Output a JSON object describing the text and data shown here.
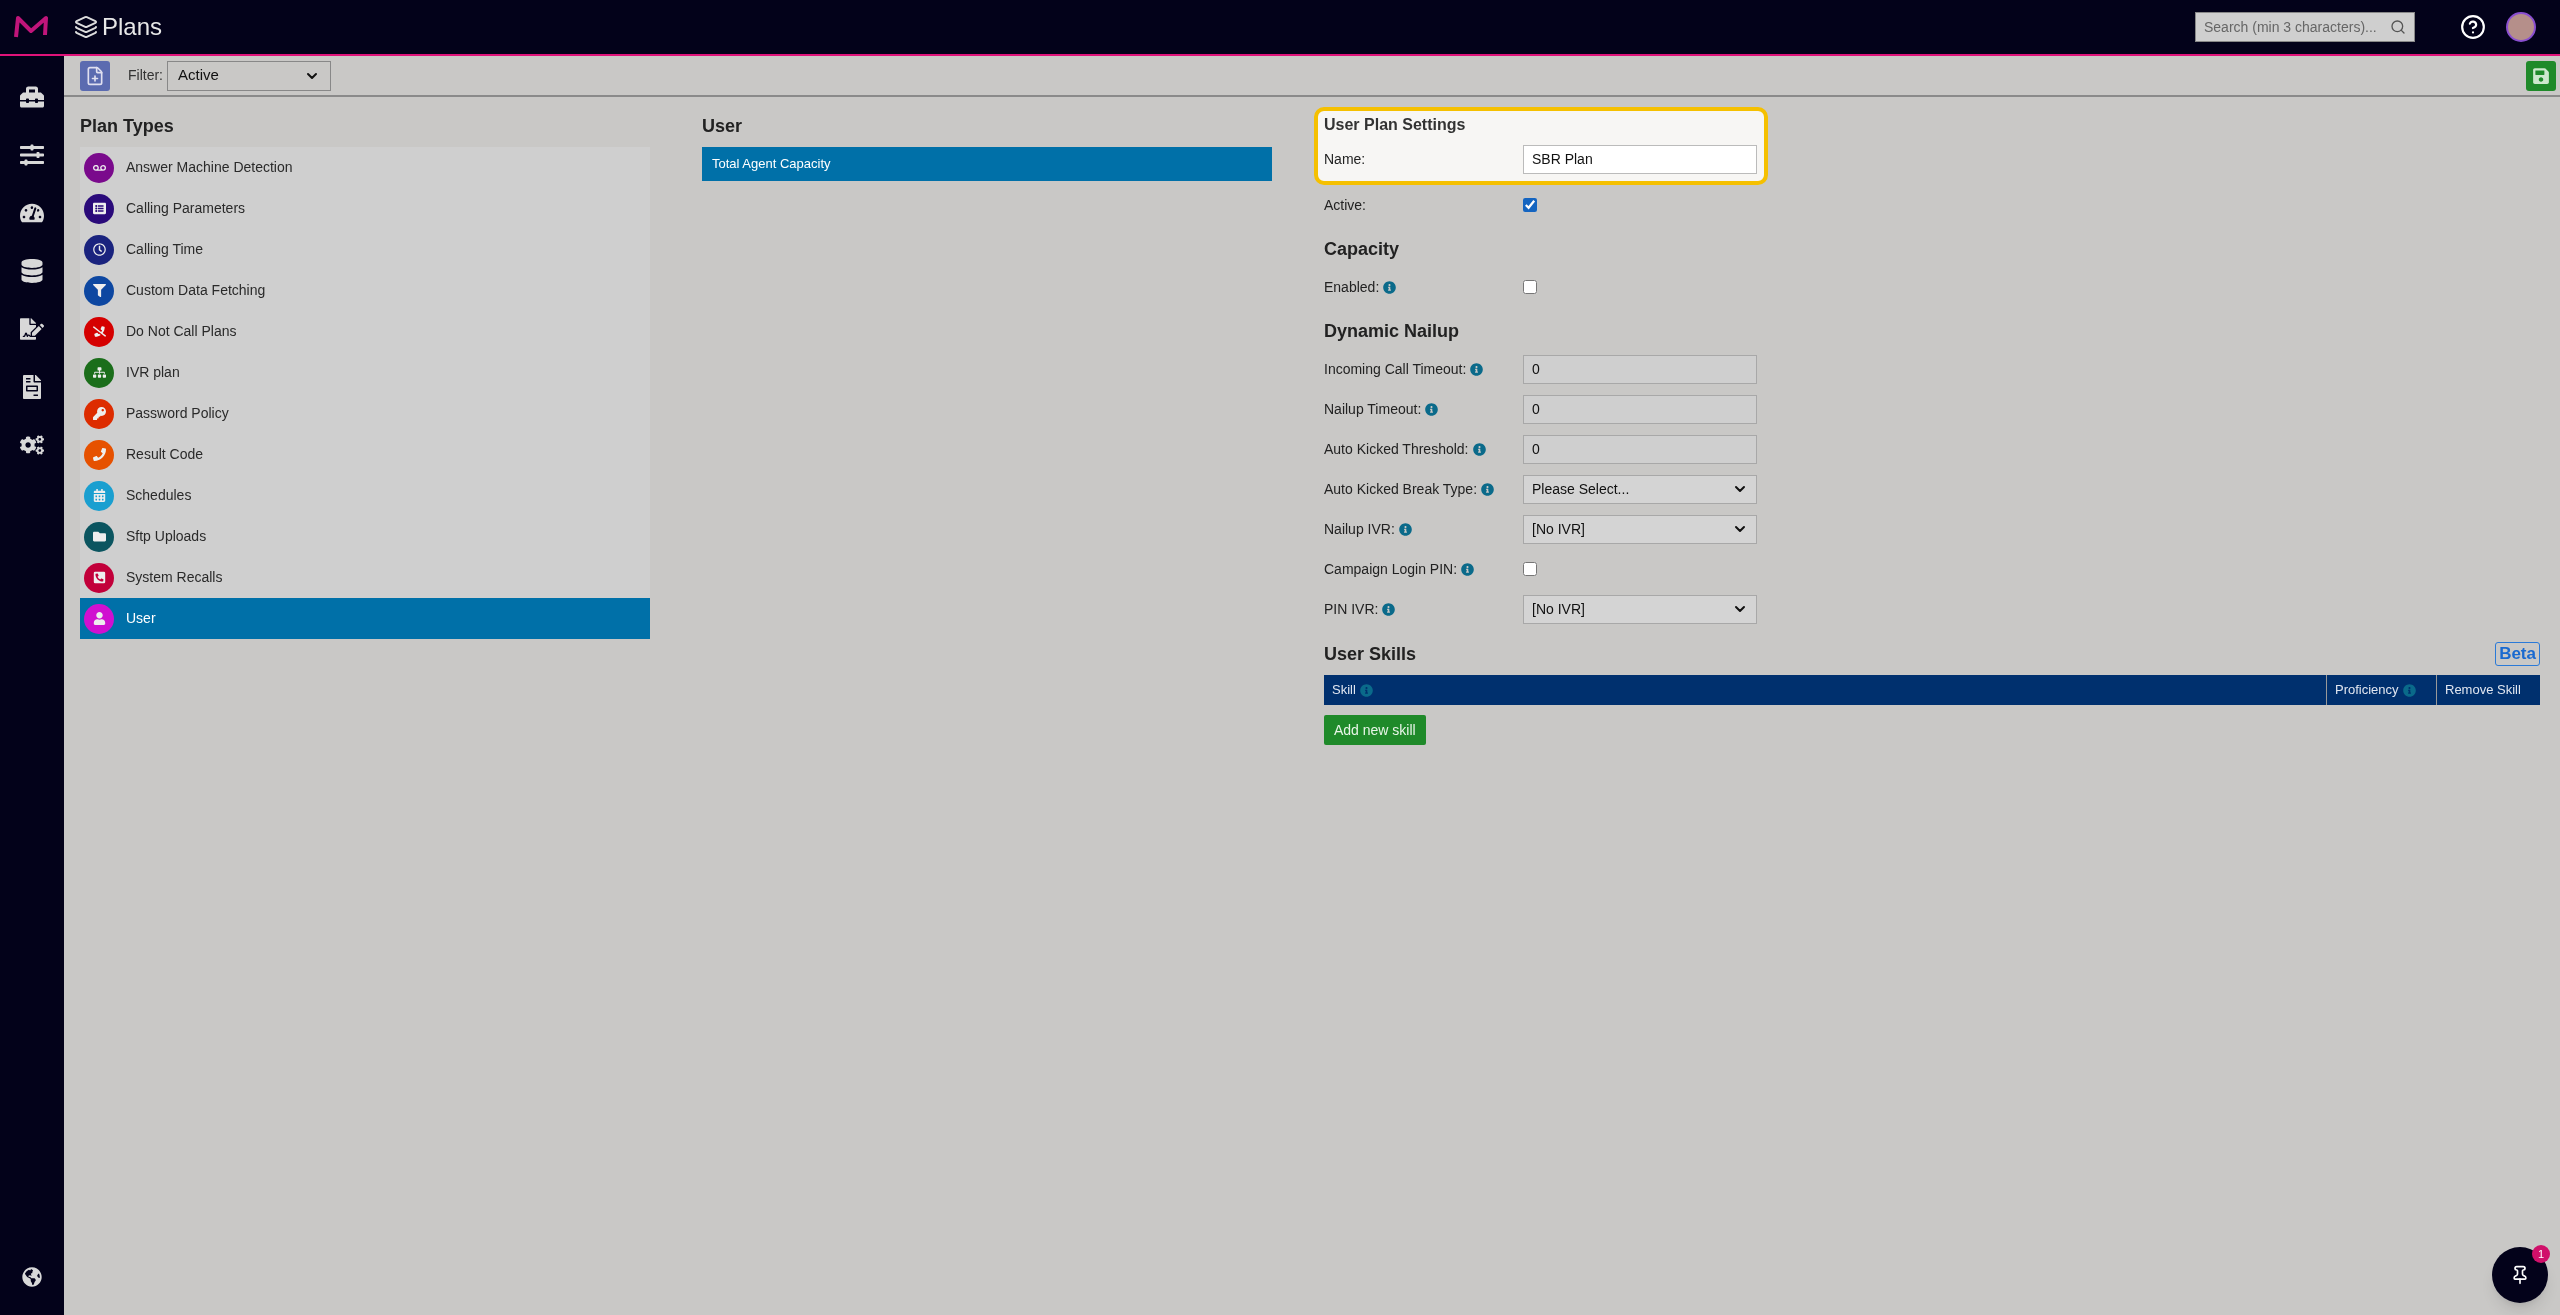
{
  "header": {
    "title": "Plans",
    "search": {
      "placeholder": "Search (min 3 characters)..."
    }
  },
  "toolbar": {
    "filter_label": "Filter:",
    "filter_value": "Active"
  },
  "plan_types": {
    "title": "Plan Types",
    "items": [
      {
        "label": "Answer Machine Detection",
        "color": "#7a0a8c",
        "selected": false
      },
      {
        "label": "Calling Parameters",
        "color": "#2a0a7a",
        "selected": false
      },
      {
        "label": "Calling Time",
        "color": "#1a237e",
        "selected": false
      },
      {
        "label": "Custom Data Fetching",
        "color": "#0d47a1",
        "selected": false
      },
      {
        "label": "Do Not Call Plans",
        "color": "#d50000",
        "selected": false
      },
      {
        "label": "IVR plan",
        "color": "#1b6e1b",
        "selected": false
      },
      {
        "label": "Password Policy",
        "color": "#dd2c00",
        "selected": false
      },
      {
        "label": "Result Code",
        "color": "#e65100",
        "selected": false
      },
      {
        "label": "Schedules",
        "color": "#1a9fd0",
        "selected": false
      },
      {
        "label": "Sftp Uploads",
        "color": "#0b5560",
        "selected": false
      },
      {
        "label": "System Recalls",
        "color": "#c2003a",
        "selected": false
      },
      {
        "label": "User",
        "color": "#d010d0",
        "selected": true
      }
    ]
  },
  "user": {
    "title": "User",
    "items": [
      {
        "label": "Total Agent Capacity",
        "selected": true
      }
    ]
  },
  "settings": {
    "title": "User Plan Settings",
    "highlighted": true,
    "name_field": {
      "label": "Name:",
      "value": "SBR Plan"
    },
    "sections": [
      {
        "rows": [
          {
            "kind": "checkbox",
            "label": "Active:",
            "info": false,
            "checked": true
          }
        ]
      },
      {
        "title": "Capacity",
        "rows": [
          {
            "kind": "checkbox",
            "label": "Enabled:",
            "info": true,
            "checked": false
          }
        ]
      },
      {
        "title": "Dynamic Nailup",
        "rows": [
          {
            "kind": "text",
            "label": "Incoming Call Timeout:",
            "info": true,
            "value": "0"
          },
          {
            "kind": "text",
            "label": "Nailup Timeout:",
            "info": true,
            "value": "0"
          },
          {
            "kind": "text",
            "label": "Auto Kicked Threshold:",
            "info": true,
            "value": "0"
          },
          {
            "kind": "select",
            "label": "Auto Kicked Break Type:",
            "info": true,
            "value": "Please Select..."
          },
          {
            "kind": "select",
            "label": "Nailup IVR:",
            "info": true,
            "value": "[No IVR]"
          },
          {
            "kind": "checkbox",
            "label": "Campaign Login PIN:",
            "info": true,
            "checked": false
          },
          {
            "kind": "select",
            "label": "PIN IVR:",
            "info": true,
            "value": "[No IVR]"
          }
        ]
      }
    ]
  },
  "user_skills": {
    "title": "User Skills",
    "badge": "Beta",
    "columns": [
      {
        "label": "Skill",
        "info": true
      },
      {
        "label": "Proficiency",
        "info": true
      },
      {
        "label": "Remove Skill",
        "info": false
      }
    ],
    "add_button": "Add new skill"
  },
  "pin_button": {
    "badge": "1"
  }
}
